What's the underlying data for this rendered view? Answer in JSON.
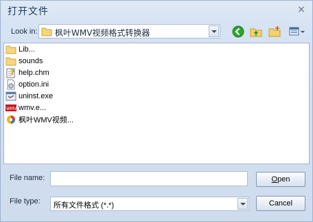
{
  "dialog": {
    "title": "打开文件",
    "close_glyph": "×"
  },
  "toolbar": {
    "lookin_label": "Look in:",
    "lookin_value": "枫叶WMV视频格式转换器",
    "icons": [
      "back-icon",
      "up-folder-icon",
      "new-folder-icon",
      "view-menu-icon"
    ]
  },
  "files": [
    {
      "name": "Lib...",
      "icon": "folder-icon"
    },
    {
      "name": "sounds",
      "icon": "folder-icon"
    },
    {
      "name": "help.chm",
      "icon": "help-file-icon"
    },
    {
      "name": "option.ini",
      "icon": "ini-file-icon"
    },
    {
      "name": "uninst.exe",
      "icon": "exe-file-icon"
    },
    {
      "name": "wmv.e...",
      "icon": "wmv-app-icon"
    },
    {
      "name": "枫叶WMV视频...",
      "icon": "app-shortcut-icon"
    }
  ],
  "form": {
    "filename_label": "File name:",
    "filename_value": "",
    "filetype_label": "File type:",
    "filetype_value": "所有文件格式 (*.*)"
  },
  "buttons": {
    "open_mnemonic": "O",
    "open_rest": "pen",
    "cancel_label": "Cancel"
  }
}
